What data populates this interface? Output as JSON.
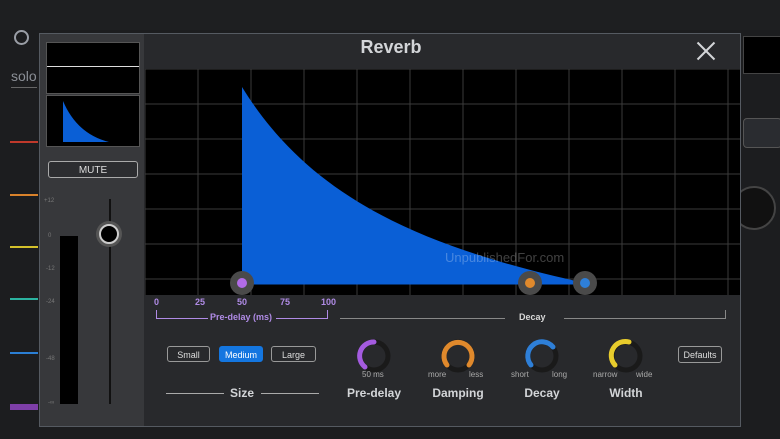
{
  "background": {
    "solo_label": "solo"
  },
  "dialog": {
    "title": "Reverb",
    "close_icon": "close-icon"
  },
  "channel_strip": {
    "mute_label": "MUTE",
    "scale": [
      "+12",
      "0",
      "-12",
      "-24",
      "-48",
      "-∞"
    ]
  },
  "graph": {
    "predelay_ticks": [
      "0",
      "25",
      "50",
      "75",
      "100"
    ],
    "predelay_label": "Pre-delay (ms)",
    "decay_label": "Decay",
    "watermark": "UnpublishedFor.com",
    "colors": {
      "fill": "#0a5fd6",
      "predelay_handle": "#b26be8",
      "damping_handle": "#e0892c",
      "decay_handle": "#2e7fd8"
    }
  },
  "size": {
    "options": [
      "Small",
      "Medium",
      "Large"
    ],
    "selected": "Medium",
    "label": "Size"
  },
  "knobs": [
    {
      "name": "Pre-delay",
      "value_text": "50 ms",
      "left": "",
      "right": "",
      "color": "#a45be0",
      "level": 0.5
    },
    {
      "name": "Damping",
      "value_text": "",
      "left": "more",
      "right": "less",
      "color": "#e0892c",
      "level": 0.5
    },
    {
      "name": "Decay",
      "value_text": "",
      "left": "short",
      "right": "long",
      "color": "#2e7fd8",
      "level": 0.5
    },
    {
      "name": "Width",
      "value_text": "",
      "left": "narrow",
      "right": "wide",
      "color": "#e8cc2c",
      "level": 0.5
    }
  ],
  "defaults_label": "Defaults"
}
